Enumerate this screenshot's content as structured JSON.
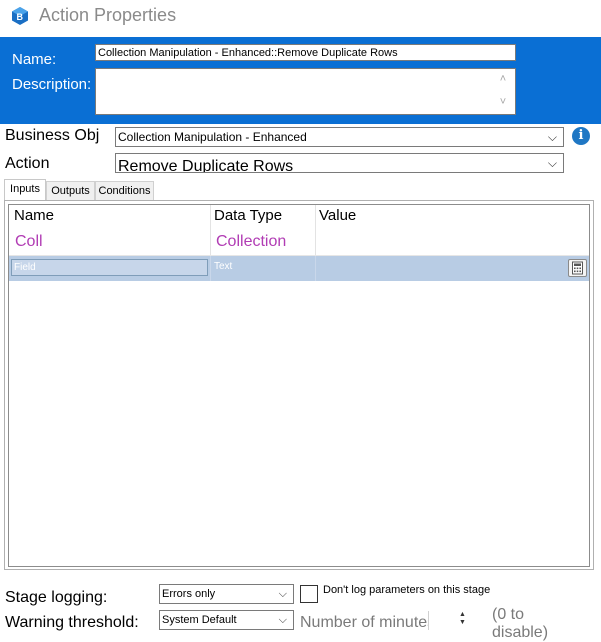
{
  "window": {
    "title": "Action Properties",
    "app_icon": "blueprism-icon"
  },
  "header": {
    "name_label": "Name:",
    "name_value": "Collection Manipulation - Enhanced::Remove Duplicate Rows",
    "description_label": "Description:",
    "description_value": "",
    "background_color": "#0a6fd4"
  },
  "business_object": {
    "label": "Business Obj",
    "value": "Collection Manipulation - Enhanced",
    "info_icon": "info-icon"
  },
  "action": {
    "label": "Action",
    "value": "Remove Duplicate Rows"
  },
  "tabs": [
    {
      "label": "Inputs",
      "selected": true
    },
    {
      "label": "Outputs",
      "selected": false
    },
    {
      "label": "Conditions",
      "selected": false
    }
  ],
  "grid": {
    "columns": [
      "Name",
      "Data Type",
      "Value"
    ],
    "rows": [
      {
        "name": "Coll",
        "type": "Collection",
        "value": ""
      },
      {
        "name": "Field",
        "type": "Text",
        "value": ""
      }
    ],
    "purple_color": "#b13cb4",
    "selected_row_color": "#b8cce4"
  },
  "stage_logging": {
    "label": "Stage logging:",
    "value": "Errors only",
    "checkbox_label": "Don't log parameters on this stage",
    "checked": false
  },
  "warning_threshold": {
    "label": "Warning threshold:",
    "value": "System Default",
    "minutes_placeholder": "Number of minutes",
    "hint": "(0 to disable)"
  }
}
